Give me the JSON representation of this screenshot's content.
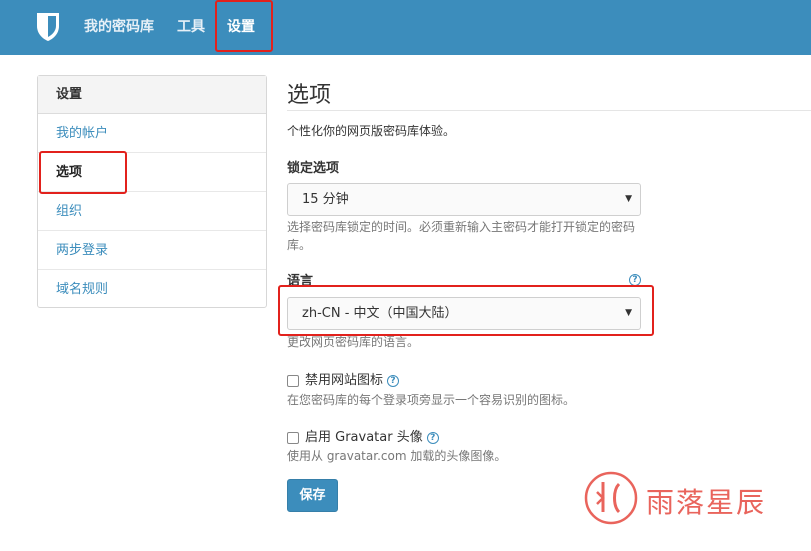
{
  "topnav": {
    "items": [
      {
        "label": "我的密码库"
      },
      {
        "label": "工具"
      },
      {
        "label": "设置"
      }
    ],
    "logo_icon": "shield-icon",
    "bg_color": "#3c8dbc"
  },
  "sidebar": {
    "heading": "设置",
    "items": [
      {
        "label": "我的帐户",
        "active": false
      },
      {
        "label": "选项",
        "active": true
      },
      {
        "label": "组织",
        "active": false
      },
      {
        "label": "两步登录",
        "active": false
      },
      {
        "label": "域名规则",
        "active": false
      }
    ]
  },
  "main": {
    "title": "选项",
    "intro": "个性化你的网页版密码库体验。",
    "lock": {
      "label": "锁定选项",
      "value": "15 分钟",
      "help": "选择密码库锁定的时间。必须重新输入主密码才能打开锁定的密码库。"
    },
    "language": {
      "label": "语言",
      "value": "zh-CN - 中文（中国大陆）",
      "help": "更改网页密码库的语言。"
    },
    "favicons": {
      "label": "禁用网站图标",
      "checked": false,
      "help": "在您密码库的每个登录项旁显示一个容易识别的图标。"
    },
    "gravatar": {
      "label": "启用 Gravatar 头像",
      "checked": false,
      "help": "使用从 gravatar.com 加载的头像图像。"
    },
    "save_label": "保存",
    "help_icon": "question-circle-icon"
  },
  "watermark": {
    "text": "雨落星辰"
  },
  "colors": {
    "accent": "#3c8dbc",
    "highlight": "#e2211c",
    "watermark": "#e9645c"
  }
}
